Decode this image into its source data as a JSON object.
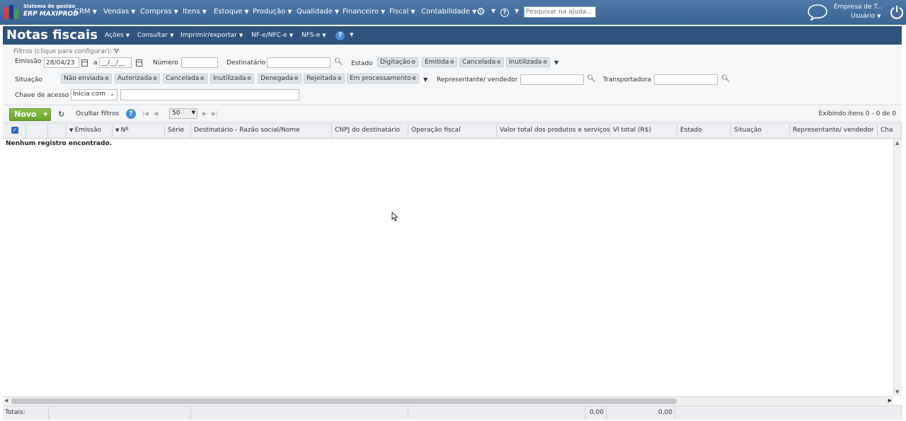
{
  "brand": {
    "line1": "Sistema de gestão",
    "line2": "ERP MAXIPROD"
  },
  "topnav": [
    "CRM",
    "Vendas",
    "Compras",
    "Itens",
    "Estoque",
    "Produção",
    "Qualidade",
    "Financeiro",
    "Fiscal",
    "Contabilidade"
  ],
  "search_placeholder": "Pesquisar na ajuda...",
  "company": "Empresa de T...",
  "user": "Usuário",
  "page_title": "Notas fiscais",
  "subnav": [
    "Ações",
    "Consultar",
    "Imprimir/exportar",
    "NF-e/NFC-e",
    "NFS-e"
  ],
  "filters": {
    "hint": "Filtros (clique para configurar)",
    "emissao_label": "Emissão",
    "emissao_from": "28/04/23",
    "a_label": "a",
    "emissao_to": "__/__/__",
    "numero_label": "Número",
    "numero_value": "",
    "destinatario_label": "Destinatário",
    "destinatario_value": "",
    "estado_label": "Estado",
    "estado_tags": [
      "Digitação",
      "Emitida",
      "Cancelada",
      "Inutilizada"
    ],
    "situacao_label": "Situação",
    "situacao_tags": [
      "Não enviada",
      "Autorizada",
      "Cancelada",
      "Inutilizada",
      "Denegada",
      "Rejeitada",
      "Em processamento"
    ],
    "representante_label": "Representante/ vendedor",
    "representante_value": "",
    "transportadora_label": "Transportadora",
    "transportadora_value": "",
    "chave_label": "Chave de acesso",
    "chave_mode": "Inicia com",
    "chave_value": ""
  },
  "toolbar": {
    "novo": "Novo",
    "ocultar": "Ocultar filtros",
    "pagesize": "50",
    "info": "Exibindo itens 0 - 0 de 0"
  },
  "columns": [
    "Emissão",
    "Nº",
    "Série",
    "Destinatário - Razão social/Nome",
    "CNPJ do destinatário",
    "Operação fiscal",
    "Valor total dos produtos e serviços",
    "Vl total (R$)",
    "Estado",
    "Situação",
    "Representante/ vendedor",
    "Cha"
  ],
  "empty_message": "Nenhum registro encontrado.",
  "footer": {
    "label": "Totais:",
    "total1": "0,00",
    "total2": "0,00"
  }
}
